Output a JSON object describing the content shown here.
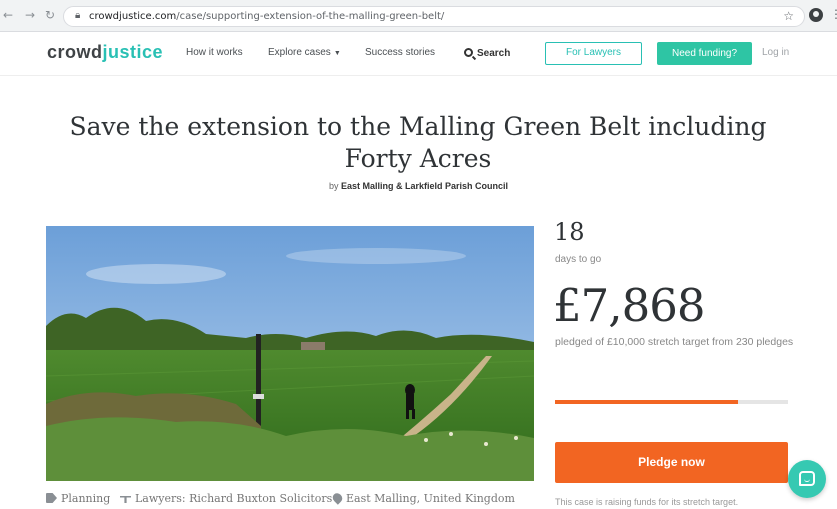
{
  "browser": {
    "url_host": "crowdjustice.com",
    "url_path": "/case/supporting-extension-of-the-malling-green-belt/"
  },
  "header": {
    "logo_part1": "crowd",
    "logo_part2": "justice",
    "nav": {
      "how": "How it works",
      "explore": "Explore cases",
      "success": "Success stories",
      "search": "Search"
    },
    "lawyers_button": "For Lawyers",
    "funding_button": "Need funding?",
    "login": "Log in"
  },
  "case": {
    "title": "Save the extension to the Malling Green Belt including Forty Acres",
    "by_prefix": "by",
    "by_name": "East Malling & Larkfield Parish Council",
    "tags": {
      "category": "Planning",
      "lawyers": "Lawyers: Richard Buxton Solicitors",
      "location": "East Malling, United Kingdom"
    }
  },
  "stats": {
    "days_left": "18",
    "days_label": "days to go",
    "amount": "£7,868",
    "pledged_text": "pledged of £10,000 stretch target from 230 pledges",
    "progress_fraction": 0.7868,
    "pledge_button": "Pledge now",
    "stretch_note": "This case is raising funds for its stretch target."
  },
  "colors": {
    "brand_teal": "#29c0b4",
    "accent_orange": "#f26522"
  },
  "icons": {
    "lock": "lock-icon",
    "star": "star-icon",
    "tag": "tag-icon",
    "scale": "scale-icon",
    "pin": "map-pin-icon",
    "chat": "chat-icon"
  }
}
